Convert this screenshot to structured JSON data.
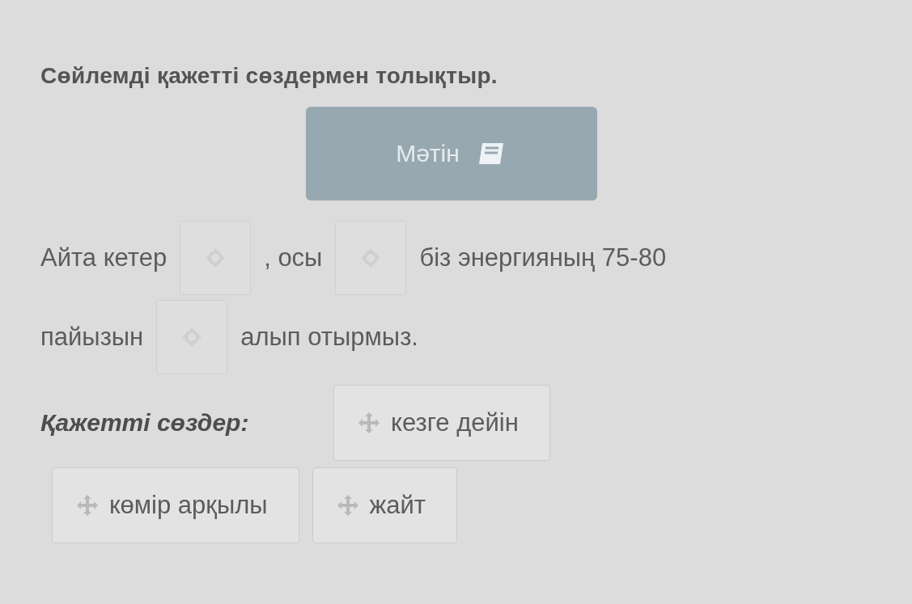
{
  "title": "Сөйлемді қажетті сөздермен толықтыр.",
  "text_button": {
    "label": "Мәтін"
  },
  "lines": [
    [
      {
        "kind": "text",
        "text": "Айта кетер"
      },
      {
        "kind": "slot"
      },
      {
        "kind": "text",
        "text": ", осы"
      },
      {
        "kind": "slot"
      },
      {
        "kind": "text",
        "text": "біз энергияның 75-80"
      }
    ],
    [
      {
        "kind": "text",
        "text": "пайызын"
      },
      {
        "kind": "slot"
      },
      {
        "kind": "text",
        "text": "алып отырмыз."
      }
    ]
  ],
  "word_bank": {
    "label": "Қажетті сөздер:",
    "words": [
      "кезге дейін",
      "көмір арқылы",
      "жайт"
    ]
  }
}
